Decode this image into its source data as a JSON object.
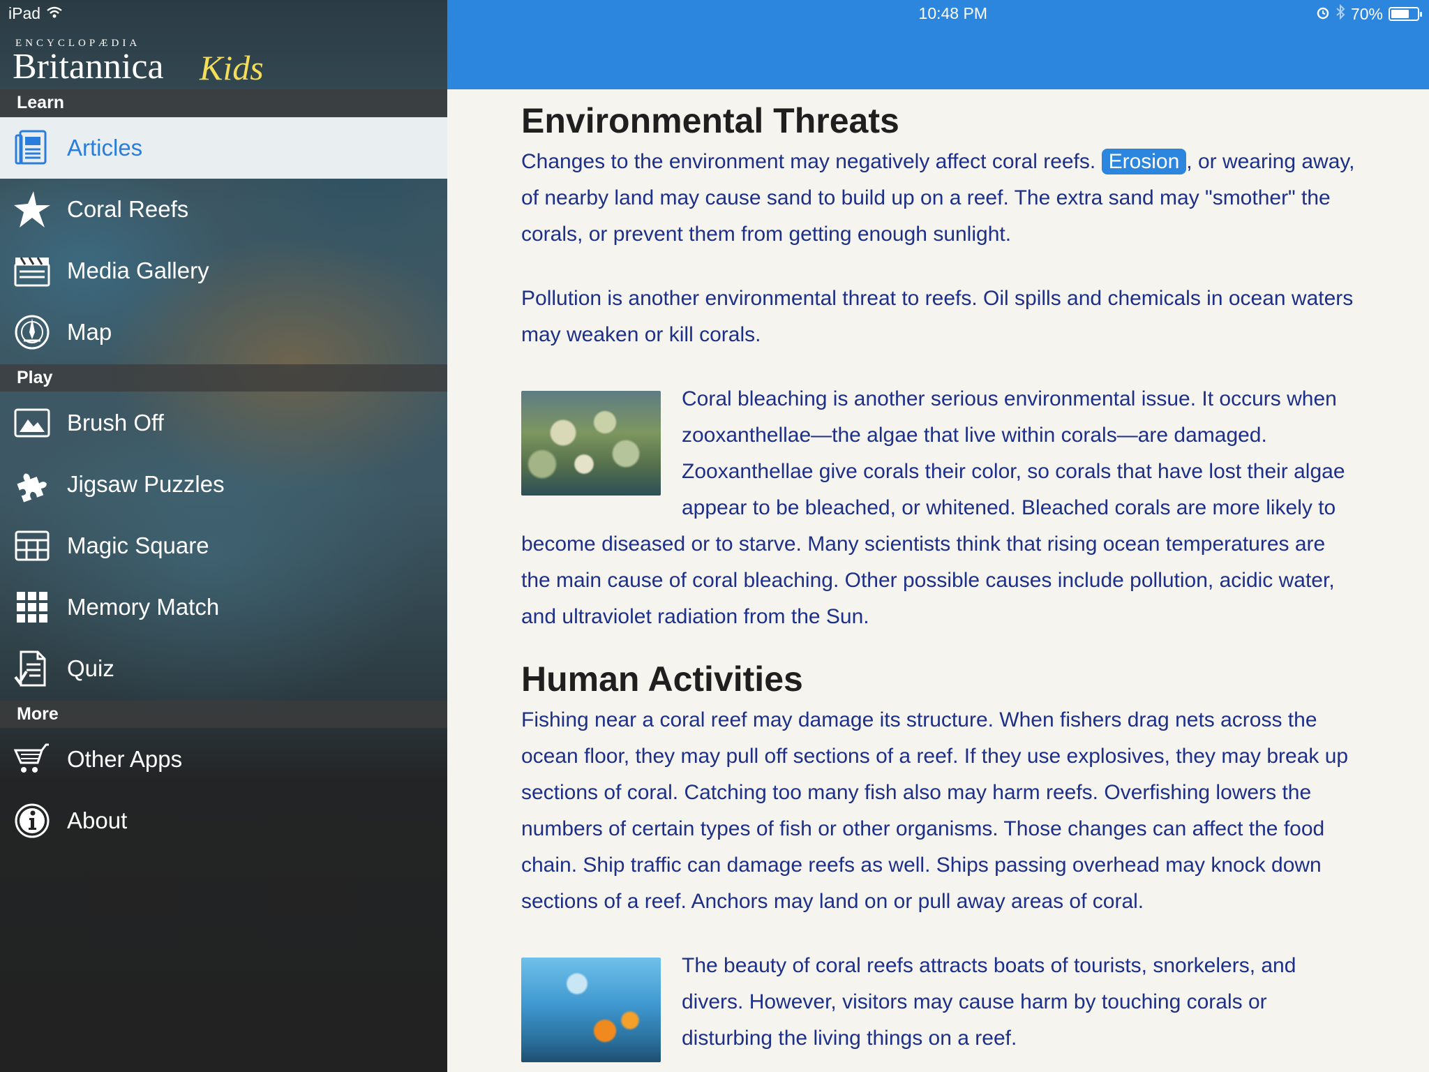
{
  "status_bar": {
    "device": "iPad",
    "time": "10:48 PM",
    "battery": "70%",
    "battery_level": 0.7
  },
  "logo": {
    "top_text": "ENCYCLOPÆDIA",
    "main_text": "Britannica",
    "kids_text": "Kids"
  },
  "sidebar": {
    "sections": [
      {
        "header": "Learn"
      },
      {
        "header": "Play"
      },
      {
        "header": "More"
      }
    ],
    "items": [
      {
        "label": "Articles",
        "icon": "article-icon",
        "active": true
      },
      {
        "label": "Coral Reefs",
        "icon": "star-icon"
      },
      {
        "label": "Media Gallery",
        "icon": "clapperboard-icon"
      },
      {
        "label": "Map",
        "icon": "map-icon"
      },
      {
        "label": "Brush Off",
        "icon": "picture-icon"
      },
      {
        "label": "Jigsaw Puzzles",
        "icon": "puzzle-icon"
      },
      {
        "label": "Magic Square",
        "icon": "grid-icon"
      },
      {
        "label": "Memory Match",
        "icon": "tiles-icon"
      },
      {
        "label": "Quiz",
        "icon": "quiz-icon"
      },
      {
        "label": "Other Apps",
        "icon": "cart-icon"
      },
      {
        "label": "About",
        "icon": "info-icon"
      }
    ]
  },
  "article": {
    "heading1": "Environmental Threats",
    "p1_before": "Changes to the environment may negatively affect coral reefs. ",
    "p1_term": "Erosion",
    "p1_after": ", or wearing away, of nearby land may cause sand to build up on a reef. The extra sand may \"smother\" the corals, or prevent them from getting enough sunlight.",
    "p2": "Pollution is another environmental threat to reefs. Oil spills and chemicals in ocean waters may weaken or kill corals.",
    "p3": "Coral bleaching is another serious environmental issue. It occurs when zooxanthellae—the algae that live within corals—are damaged. Zooxanthellae give corals their color, so corals that have lost their algae appear to be bleached, or whitened. Bleached corals are more likely to become diseased or to starve. Many scientists think that rising ocean temperatures are the main cause of coral bleaching. Other possible causes include pollution, acidic water, and ultraviolet radiation from the Sun.",
    "heading2": "Human Activities",
    "p4": "Fishing near a coral reef may damage its structure. When fishers drag nets across the ocean floor, they may pull off sections of a reef. If they use explosives, they may break up sections of coral. Catching too many fish also may harm reefs. Overfishing lowers the numbers of certain types of fish or other organisms. Those changes can affect the food chain. Ship traffic can damage reefs as well. Ships passing overhead may knock down sections of a reef. Anchors may land on or pull away areas of coral.",
    "p5": "The beauty of coral reefs attracts boats of tourists, snorkelers, and divers. However, visitors may cause harm by touching corals or disturbing the living things on a reef."
  }
}
